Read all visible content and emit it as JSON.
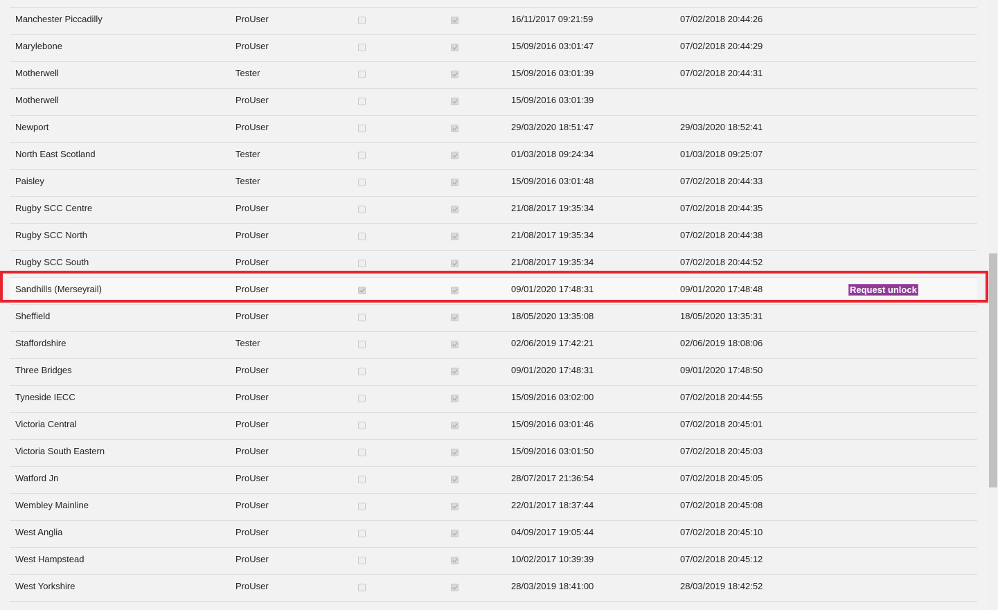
{
  "table": {
    "rows": [
      {
        "name": "Manchester Piccadilly",
        "role": "ProUser",
        "flag1": false,
        "flag2": true,
        "created": "16/11/2017 09:21:59",
        "last": "07/02/2018 20:44:26",
        "action": ""
      },
      {
        "name": "Marylebone",
        "role": "ProUser",
        "flag1": false,
        "flag2": true,
        "created": "15/09/2016 03:01:47",
        "last": "07/02/2018 20:44:29",
        "action": ""
      },
      {
        "name": "Motherwell",
        "role": "Tester",
        "flag1": false,
        "flag2": true,
        "created": "15/09/2016 03:01:39",
        "last": "07/02/2018 20:44:31",
        "action": ""
      },
      {
        "name": "Motherwell",
        "role": "ProUser",
        "flag1": false,
        "flag2": true,
        "created": "15/09/2016 03:01:39",
        "last": "",
        "action": ""
      },
      {
        "name": "Newport",
        "role": "ProUser",
        "flag1": false,
        "flag2": true,
        "created": "29/03/2020 18:51:47",
        "last": "29/03/2020 18:52:41",
        "action": ""
      },
      {
        "name": "North East Scotland",
        "role": "Tester",
        "flag1": false,
        "flag2": true,
        "created": "01/03/2018 09:24:34",
        "last": "01/03/2018 09:25:07",
        "action": ""
      },
      {
        "name": "Paisley",
        "role": "Tester",
        "flag1": false,
        "flag2": true,
        "created": "15/09/2016 03:01:48",
        "last": "07/02/2018 20:44:33",
        "action": ""
      },
      {
        "name": "Rugby SCC Centre",
        "role": "ProUser",
        "flag1": false,
        "flag2": true,
        "created": "21/08/2017 19:35:34",
        "last": "07/02/2018 20:44:35",
        "action": ""
      },
      {
        "name": "Rugby SCC North",
        "role": "ProUser",
        "flag1": false,
        "flag2": true,
        "created": "21/08/2017 19:35:34",
        "last": "07/02/2018 20:44:38",
        "action": ""
      },
      {
        "name": "Rugby SCC South",
        "role": "ProUser",
        "flag1": false,
        "flag2": true,
        "created": "21/08/2017 19:35:34",
        "last": "07/02/2018 20:44:52",
        "action": ""
      },
      {
        "name": "Sandhills (Merseyrail)",
        "role": "ProUser",
        "flag1": true,
        "flag2": true,
        "created": "09/01/2020 17:48:31",
        "last": "09/01/2020 17:48:48",
        "action": "Request unlock",
        "highlighted": true
      },
      {
        "name": "Sheffield",
        "role": "ProUser",
        "flag1": false,
        "flag2": true,
        "created": "18/05/2020 13:35:08",
        "last": "18/05/2020 13:35:31",
        "action": ""
      },
      {
        "name": "Staffordshire",
        "role": "Tester",
        "flag1": false,
        "flag2": true,
        "created": "02/06/2019 17:42:21",
        "last": "02/06/2019 18:08:06",
        "action": ""
      },
      {
        "name": "Three Bridges",
        "role": "ProUser",
        "flag1": false,
        "flag2": true,
        "created": "09/01/2020 17:48:31",
        "last": "09/01/2020 17:48:50",
        "action": ""
      },
      {
        "name": "Tyneside IECC",
        "role": "ProUser",
        "flag1": false,
        "flag2": true,
        "created": "15/09/2016 03:02:00",
        "last": "07/02/2018 20:44:55",
        "action": ""
      },
      {
        "name": "Victoria Central",
        "role": "ProUser",
        "flag1": false,
        "flag2": true,
        "created": "15/09/2016 03:01:46",
        "last": "07/02/2018 20:45:01",
        "action": ""
      },
      {
        "name": "Victoria South Eastern",
        "role": "ProUser",
        "flag1": false,
        "flag2": true,
        "created": "15/09/2016 03:01:50",
        "last": "07/02/2018 20:45:03",
        "action": ""
      },
      {
        "name": "Watford Jn",
        "role": "ProUser",
        "flag1": false,
        "flag2": true,
        "created": "28/07/2017 21:36:54",
        "last": "07/02/2018 20:45:05",
        "action": ""
      },
      {
        "name": "Wembley Mainline",
        "role": "ProUser",
        "flag1": false,
        "flag2": true,
        "created": "22/01/2017 18:37:44",
        "last": "07/02/2018 20:45:08",
        "action": ""
      },
      {
        "name": "West Anglia",
        "role": "ProUser",
        "flag1": false,
        "flag2": true,
        "created": "04/09/2017 19:05:44",
        "last": "07/02/2018 20:45:10",
        "action": ""
      },
      {
        "name": "West Hampstead",
        "role": "ProUser",
        "flag1": false,
        "flag2": true,
        "created": "10/02/2017 10:39:39",
        "last": "07/02/2018 20:45:12",
        "action": ""
      },
      {
        "name": "West Yorkshire",
        "role": "ProUser",
        "flag1": false,
        "flag2": true,
        "created": "28/03/2019 18:41:00",
        "last": "28/03/2019 18:42:52",
        "action": ""
      }
    ]
  },
  "colors": {
    "highlight_border": "#e8232b",
    "unlock_button": "#8e3c96"
  }
}
